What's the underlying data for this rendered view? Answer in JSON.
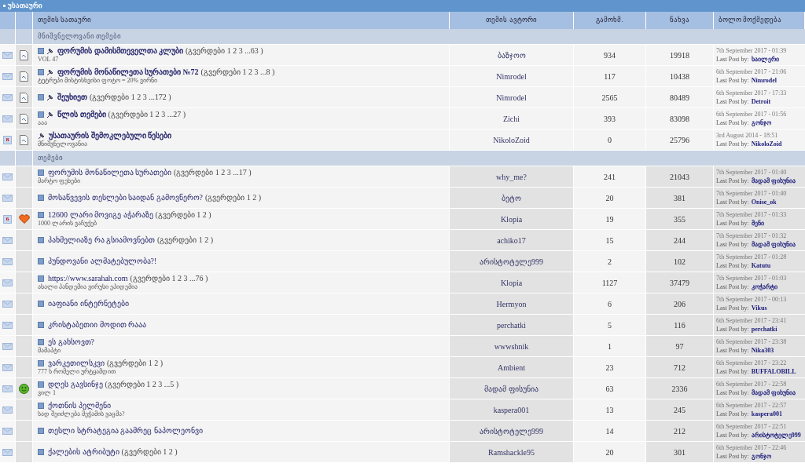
{
  "title_bar": {
    "title": "უსათაური"
  },
  "columns": [
    "თემის სათაური",
    "თემის ავტორი",
    "გამოხმ.",
    "ნახვა",
    "ბოლო მოქმედება"
  ],
  "sections": [
    {
      "title": "მნიშვნელოვანი თემები",
      "pinned": true,
      "topics": [
        {
          "status": {
            "kind": "envelope"
          },
          "kind": "document",
          "new_posts": true,
          "pin": true,
          "title": "ფორუმის დამისმთეველთა კლუბი",
          "pages": "(გვერდები 1 2 3 ...63 )",
          "description": "VOL 47",
          "author": "ბაზჯოო",
          "replies": "934",
          "views": "19918",
          "last_date": "7th September 2017 - 01:39",
          "last_label": "Last Post by:",
          "last_by": "ხაილერი"
        },
        {
          "status": {
            "kind": "envelope"
          },
          "kind": "document",
          "new_posts": true,
          "pin": true,
          "title": "ფორუმის მონაწილეთა სურათები №72",
          "pages": "(გვერდები 1 2 3 ...8 )",
          "description": "ტუტრუპი მისტისხვისი ფოტო = 20% ვირნი",
          "author": "Nimrodel",
          "replies": "117",
          "views": "10438",
          "last_date": "6th September 2017 - 21:06",
          "last_label": "Last Post by:",
          "last_by": "Nimrodel"
        },
        {
          "status": {
            "kind": "envelope"
          },
          "kind": "document",
          "new_posts": true,
          "pin": true,
          "title": "შეუხიეთ",
          "pages": "(გვერდები 1 2 3 ...172 )",
          "author": "Nimrodel",
          "replies": "2565",
          "views": "80489",
          "last_date": "6th September 2017 - 17:33",
          "last_label": "Last Post by:",
          "last_by": "Detroit"
        },
        {
          "status": {
            "kind": "envelope"
          },
          "kind": "document",
          "new_posts": true,
          "pin": true,
          "title": "წლის თემები",
          "pages": "(გვერდები 1 2 3 ...27 )",
          "description": "ააა",
          "author": "Zichi",
          "replies": "393",
          "views": "83098",
          "last_date": "6th September 2017 - 01:56",
          "last_label": "Last Post by:",
          "last_by": "გონჯო"
        },
        {
          "status": {
            "kind": "hot",
            "count": "8"
          },
          "kind": "document",
          "new_posts": false,
          "pin": true,
          "title": "უსათაურის შემოკლებული წესები",
          "description": "მნიშვნელოვანია",
          "author": "NikoloZoid",
          "replies": "0",
          "views": "25796",
          "last_date": "3rd August 2014 - 18:51",
          "last_label": "Last Post by:",
          "last_by": "NikoloZoid"
        }
      ]
    },
    {
      "title": "თემები",
      "pinned": false,
      "topics": [
        {
          "status": {
            "kind": "envelope"
          },
          "new_posts": true,
          "pin": false,
          "title": "ფორუმის მონაწილეთა სურათები",
          "pages": "(გვერდები 1 2 3 ...17 )",
          "description": "მარტო ფეხები",
          "author": "why_me?",
          "replies": "241",
          "views": "21043",
          "last_date": "7th September 2017 - 01:40",
          "last_label": "Last Post by:",
          "last_by": "მადამ ფისუნია"
        },
        {
          "status": {
            "kind": "envelope"
          },
          "new_posts": true,
          "pin": false,
          "title": "მოსაწვევის თესლები საიდან გამოვწერო?",
          "pages": "(გვერდები 1 2 )",
          "author": "ბეტო",
          "replies": "20",
          "views": "381",
          "last_date": "7th September 2017 - 01:40",
          "last_label": "Last Post by:",
          "last_by": "Onise_ok"
        },
        {
          "status": {
            "kind": "hot",
            "count": "6"
          },
          "kind": "heart",
          "new_posts": true,
          "pin": false,
          "title": "12600 ლარი მოვიგე აჭარაზე",
          "pages": "(გვერდები 1 2 )",
          "description": "1000 ლარის ვაჩუქებ",
          "author": "Klopia",
          "replies": "19",
          "views": "355",
          "last_date": "7th September 2017 - 01:33",
          "last_label": "Last Post by:",
          "last_by": "მენი"
        },
        {
          "status": {
            "kind": "envelope"
          },
          "new_posts": true,
          "pin": false,
          "title": "პახმელიაზე რა გსიამოვნებთ",
          "pages": "(გვერდები 1 2 )",
          "author": "achiko17",
          "replies": "15",
          "views": "244",
          "last_date": "7th September 2017 - 01:32",
          "last_label": "Last Post by:",
          "last_by": "მადამ ფისუნია"
        },
        {
          "status": {
            "kind": "envelope"
          },
          "new_posts": true,
          "pin": false,
          "title": "პუნდოვანი ალმატებულობა?!",
          "author": "არისტოტელე999",
          "replies": "2",
          "views": "102",
          "last_date": "7th September 2017 - 01:28",
          "last_label": "Last Post by:",
          "last_by": "Katutu"
        },
        {
          "status": {
            "kind": "envelope"
          },
          "new_posts": true,
          "pin": false,
          "title": "https://www.sarahah.com",
          "pages": "(გვერდები 1 2 3 ...76 )",
          "description": "ახალი პანდემია ვირუსი ეპიდემია",
          "author": "Klopia",
          "replies": "1127",
          "views": "37479",
          "last_date": "7th September 2017 - 01:03",
          "last_label": "Last Post by:",
          "last_by": "კოჭარტი"
        },
        {
          "status": {
            "kind": "envelope"
          },
          "new_posts": true,
          "pin": false,
          "title": "იაფიანი ინტერნეტები",
          "author": "Hermyon",
          "replies": "6",
          "views": "206",
          "last_date": "7th September 2017 - 00:13",
          "last_label": "Last Post by:",
          "last_by": "Vikus"
        },
        {
          "status": {
            "kind": "envelope"
          },
          "new_posts": true,
          "pin": false,
          "title": "კრისტაბეთიი მოდით რააა",
          "author": "perchatki",
          "replies": "5",
          "views": "116",
          "last_date": "6th September 2017 - 23:41",
          "last_label": "Last Post by:",
          "last_by": "perchatki"
        },
        {
          "status": {
            "kind": "envelope"
          },
          "new_posts": true,
          "pin": false,
          "title": "ეს გახსოვთ?",
          "description": "მამაპტი",
          "author": "wwwshnik",
          "replies": "1",
          "views": "97",
          "last_date": "6th September 2017 - 23:38",
          "last_label": "Last Post by:",
          "last_by": "Nika303"
        },
        {
          "status": {
            "kind": "envelope"
          },
          "new_posts": true,
          "pin": false,
          "title": "ვარკეთილსკვი",
          "pages": "(გვერდები 1 2 )",
          "description": "777 ს რომელი ურტყამდით",
          "author": "Ambient",
          "replies": "23",
          "views": "712",
          "last_date": "6th September 2017 - 23:22",
          "last_label": "Last Post by:",
          "last_by": "BUFFALOBILL"
        },
        {
          "status": {
            "kind": "envelope"
          },
          "kind": "smiley",
          "new_posts": true,
          "pin": false,
          "title": "დღეს გავსინჯე",
          "pages": "(გვერდები 1 2 3 ...5 )",
          "description": "ვილ 1",
          "author": "მადამ ფისუნია",
          "replies": "63",
          "views": "2336",
          "last_date": "6th September 2017 - 22:58",
          "last_label": "Last Post by:",
          "last_by": "მადამ ფისუნია"
        },
        {
          "status": {
            "kind": "envelope"
          },
          "new_posts": true,
          "pin": false,
          "title": "ქოთნის პელმენი",
          "description": "სად შეიძლება მეჭამის ვაცმა?",
          "author": "kaspera001",
          "replies": "13",
          "views": "245",
          "last_date": "6th September 2017 - 22:57",
          "last_label": "Last Post by:",
          "last_by": "kaspera001"
        },
        {
          "status": {
            "kind": "envelope"
          },
          "new_posts": true,
          "pin": false,
          "title": "თესლი სტრატეგია გაამრეც ნაპოლეონვი",
          "author": "არისტოტელე999",
          "replies": "14",
          "views": "212",
          "last_date": "6th September 2017 - 22:51",
          "last_label": "Last Post by:",
          "last_by": "არისტოტელე999"
        },
        {
          "status": {
            "kind": "envelope"
          },
          "new_posts": true,
          "pin": false,
          "title": "ქალების ატრიბუტი",
          "pages": "(გვერდები 1 2 )",
          "author": "Ramshackle95",
          "replies": "20",
          "views": "301",
          "last_date": "6th September 2017 - 22:46",
          "last_label": "Last Post by:",
          "last_by": "გონჯო"
        }
      ]
    }
  ]
}
